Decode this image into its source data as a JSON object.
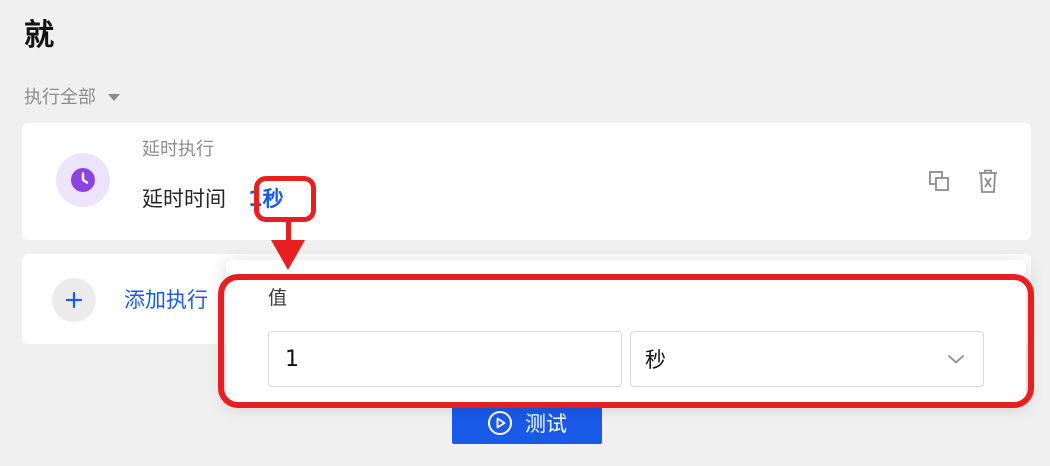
{
  "section": {
    "title": "就"
  },
  "mode": {
    "label": "执行全部"
  },
  "action": {
    "type": "延时执行",
    "param_label": "延时时间",
    "value_display": "1秒"
  },
  "add": {
    "label": "添加执行"
  },
  "popover": {
    "field_label": "值",
    "value": "1",
    "unit": "秒"
  },
  "test": {
    "label": "测试"
  },
  "colors": {
    "accent": "#1a5ae8",
    "highlight": "#e62020",
    "clock_bg": "#ede4fb",
    "clock_fg": "#8a45e0"
  },
  "icons": {
    "clock": "clock-icon",
    "copy": "copy-icon",
    "delete": "delete-icon",
    "plus": "plus-icon",
    "chevron": "chevron-down-icon",
    "play": "play-icon"
  }
}
